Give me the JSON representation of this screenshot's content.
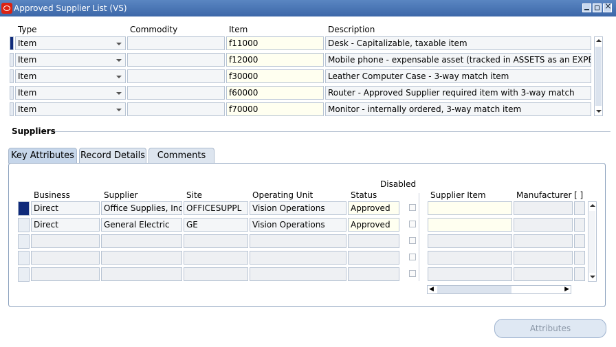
{
  "window": {
    "title": "Approved Supplier List (VS)"
  },
  "items_table": {
    "headers": {
      "type": "Type",
      "commodity": "Commodity",
      "item": "Item",
      "description": "Description"
    },
    "rows": [
      {
        "type": "Item",
        "commodity": "",
        "item": "f11000",
        "description": "Desk - Capitalizable, taxable item"
      },
      {
        "type": "Item",
        "commodity": "",
        "item": "f12000",
        "description": "Mobile phone - expensable asset (tracked in ASSETS as an EXPE"
      },
      {
        "type": "Item",
        "commodity": "",
        "item": "f30000",
        "description": "Leather Computer Case -  3-way match item"
      },
      {
        "type": "Item",
        "commodity": "",
        "item": "f60000",
        "description": "Router - Approved Supplier required item with 3-way match"
      },
      {
        "type": "Item",
        "commodity": "",
        "item": "f70000",
        "description": "Monitor - internally ordered, 3-way match item"
      }
    ]
  },
  "suppliers_section": {
    "title": "Suppliers"
  },
  "tabs": [
    "Key Attributes",
    "Record Details",
    "Comments"
  ],
  "suppliers_table": {
    "headers": {
      "business": "Business",
      "supplier": "Supplier",
      "site": "Site",
      "operating_unit": "Operating Unit",
      "status": "Status",
      "disabled": "Disabled",
      "supplier_item": "Supplier Item",
      "manufacturer": "Manufacturer",
      "extra": "[ ]"
    },
    "rows": [
      {
        "business": "Direct",
        "supplier": "Office Supplies, Inc.",
        "site": "OFFICESUPPL",
        "operating_unit": "Vision Operations",
        "status": "Approved",
        "supplier_item": "",
        "manufacturer": ""
      },
      {
        "business": "Direct",
        "supplier": "General Electric",
        "site": "GE",
        "operating_unit": "Vision Operations",
        "status": "Approved",
        "supplier_item": "",
        "manufacturer": ""
      }
    ]
  },
  "buttons": {
    "attributes": "Attributes"
  }
}
